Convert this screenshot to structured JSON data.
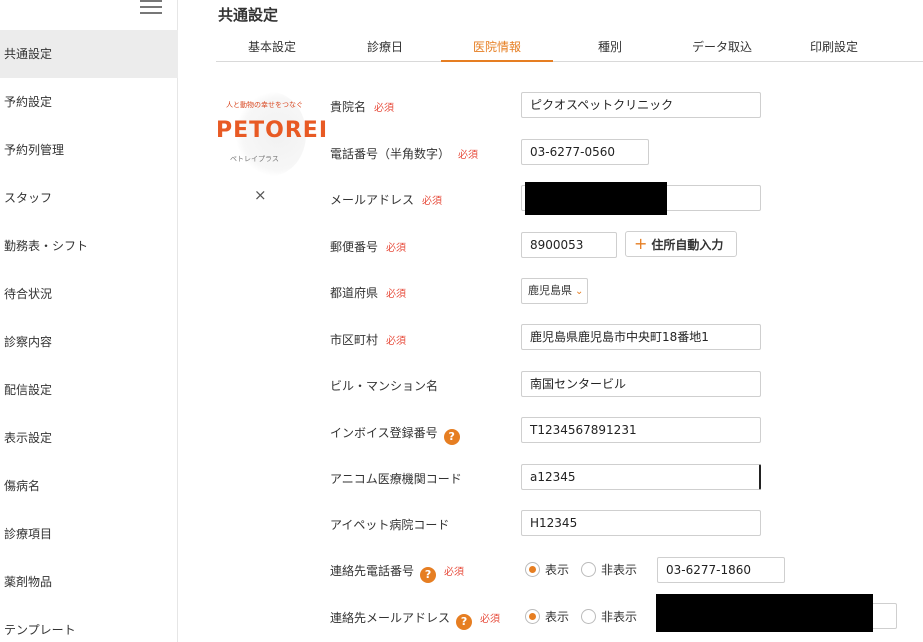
{
  "sidebar": {
    "items": [
      {
        "label": "共通設定",
        "active": true
      },
      {
        "label": "予約設定"
      },
      {
        "label": "予約列管理"
      },
      {
        "label": "スタッフ"
      },
      {
        "label": "勤務表・シフト"
      },
      {
        "label": "待合状況"
      },
      {
        "label": "診察内容"
      },
      {
        "label": "配信設定"
      },
      {
        "label": "表示設定"
      },
      {
        "label": "傷病名"
      },
      {
        "label": "診療項目"
      },
      {
        "label": "薬剤物品"
      },
      {
        "label": "テンプレート"
      }
    ]
  },
  "header": {
    "title": "共通設定"
  },
  "tabs": [
    {
      "label": "基本設定"
    },
    {
      "label": "診療日"
    },
    {
      "label": "医院情報",
      "active": true
    },
    {
      "label": "種別"
    },
    {
      "label": "データ取込"
    },
    {
      "label": "印刷設定"
    }
  ],
  "logo": {
    "top_text": "人と動物の幸せをつなぐ",
    "wordmark": "PETOREI",
    "sub_text": "ペトレイプラス",
    "close_glyph": "×"
  },
  "form": {
    "required_label": "必須",
    "help_glyph": "?",
    "clinic_name": {
      "label": "貴院名",
      "value": "ピクオスペットクリニック"
    },
    "phone": {
      "label": "電話番号（半角数字）",
      "value": "03-6277-0560"
    },
    "email": {
      "label": "メールアドレス",
      "value": ""
    },
    "postal": {
      "label": "郵便番号",
      "value": "8900053",
      "button": "住所自動入力"
    },
    "prefecture": {
      "label": "都道府県",
      "value": "鹿児島県"
    },
    "city": {
      "label": "市区町村",
      "value": "鹿児島県鹿児島市中央町18番地1"
    },
    "building": {
      "label": "ビル・マンション名",
      "value": "南国センタービル"
    },
    "invoice": {
      "label": "インボイス登録番号",
      "value": "T1234567891231"
    },
    "anicom": {
      "label": "アニコム医療機関コード",
      "value": "a12345"
    },
    "ipet": {
      "label": "アイペット病院コード",
      "value": "H12345"
    },
    "contact_phone": {
      "label": "連絡先電話番号",
      "show": "表示",
      "hide": "非表示",
      "value": "03-6277-1860"
    },
    "contact_email": {
      "label": "連絡先メールアドレス",
      "show": "表示",
      "hide": "非表示",
      "value": ""
    }
  },
  "colors": {
    "accent": "#e67e22",
    "required": "#e74c3c"
  }
}
